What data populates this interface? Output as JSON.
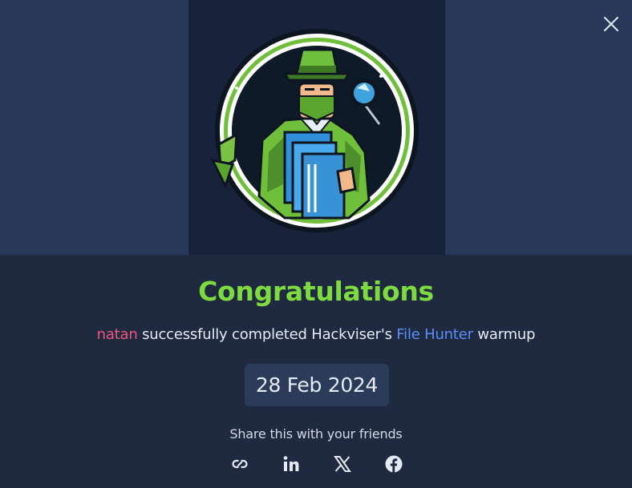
{
  "modal": {
    "close_icon": "close-icon",
    "badge_image": "file-hunter-badge-detective",
    "title": "Congratulations",
    "message": {
      "username": "natan",
      "text_before": " successfully completed Hackviser's ",
      "lab_name": "File Hunter",
      "text_after": " warmup"
    },
    "date": "28 Feb 2024",
    "share_label": "Share this with your friends",
    "share_icons": [
      "link-icon",
      "linkedin-icon",
      "x-icon",
      "facebook-icon"
    ]
  },
  "colors": {
    "title": "#7ddb3f",
    "username": "#f0547c",
    "lab_name": "#5b8ef8",
    "banner": "#27385a",
    "badge_panel": "#18223a",
    "body": "#1f2a40"
  }
}
